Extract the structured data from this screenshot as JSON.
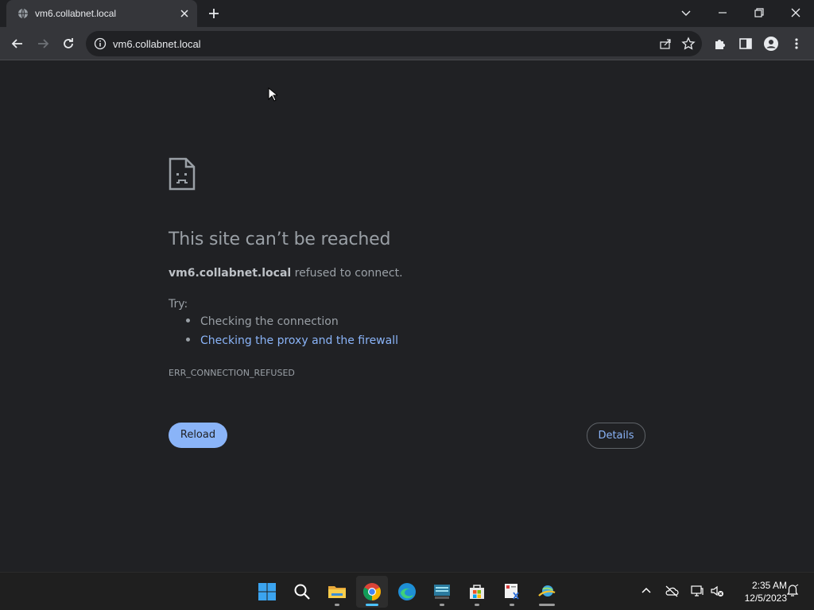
{
  "browser": {
    "tab": {
      "title": "vm6.collabnet.local"
    },
    "address_bar": {
      "url": "vm6.collabnet.local"
    }
  },
  "error_page": {
    "title": "This site can’t be reached",
    "host": "vm6.collabnet.local",
    "message": " refused to connect.",
    "try_label": "Try:",
    "suggestions": [
      {
        "text": "Checking the connection",
        "is_link": false
      },
      {
        "text": "Checking the proxy and the firewall",
        "is_link": true
      }
    ],
    "error_code": "ERR_CONNECTION_REFUSED",
    "reload_label": "Reload",
    "details_label": "Details"
  },
  "taskbar": {
    "apps": [
      "start-icon",
      "search-icon",
      "file-explorer-icon",
      "chrome-icon",
      "edge-icon",
      "keyboard-app-icon",
      "store-icon",
      "snipping-tool-icon",
      "network-globe-icon"
    ],
    "clock": {
      "time": "2:35 AM",
      "date": "12/5/2023"
    }
  },
  "colors": {
    "background": "#202124",
    "toolbar": "#35363a",
    "link": "#8ab4f8",
    "text_secondary": "#9aa0a6",
    "taskbar": "#1f1f1f"
  }
}
